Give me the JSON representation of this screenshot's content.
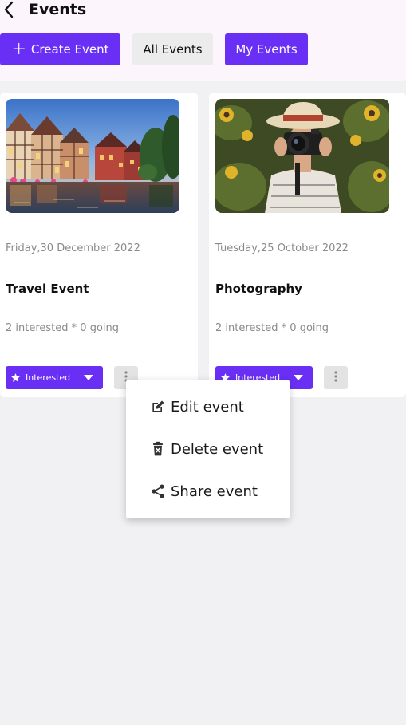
{
  "header": {
    "title": "Events",
    "back_icon": "chevron-left-icon"
  },
  "tabs": {
    "create_label": "Create Event",
    "all_label": "All Events",
    "my_label": "My Events"
  },
  "colors": {
    "accent": "#6a2ff5",
    "header_bg": "#fcf5fc",
    "page_bg": "#f1f0f2"
  },
  "events": [
    {
      "date": "Friday,30 December 2022",
      "title": "Travel Event",
      "stats": "2 interested * 0 going",
      "interested_label": "Interested",
      "image": "colmar-canal-photo"
    },
    {
      "date": "Tuesday,25 October 2022",
      "title": "Photography",
      "stats": "2 interested * 0 going",
      "interested_label": "Interested",
      "image": "photographer-photo"
    }
  ],
  "menu": {
    "items": [
      {
        "label": "Edit event",
        "icon": "edit-icon"
      },
      {
        "label": "Delete event",
        "icon": "delete-icon"
      },
      {
        "label": "Share event",
        "icon": "share-icon"
      }
    ]
  }
}
